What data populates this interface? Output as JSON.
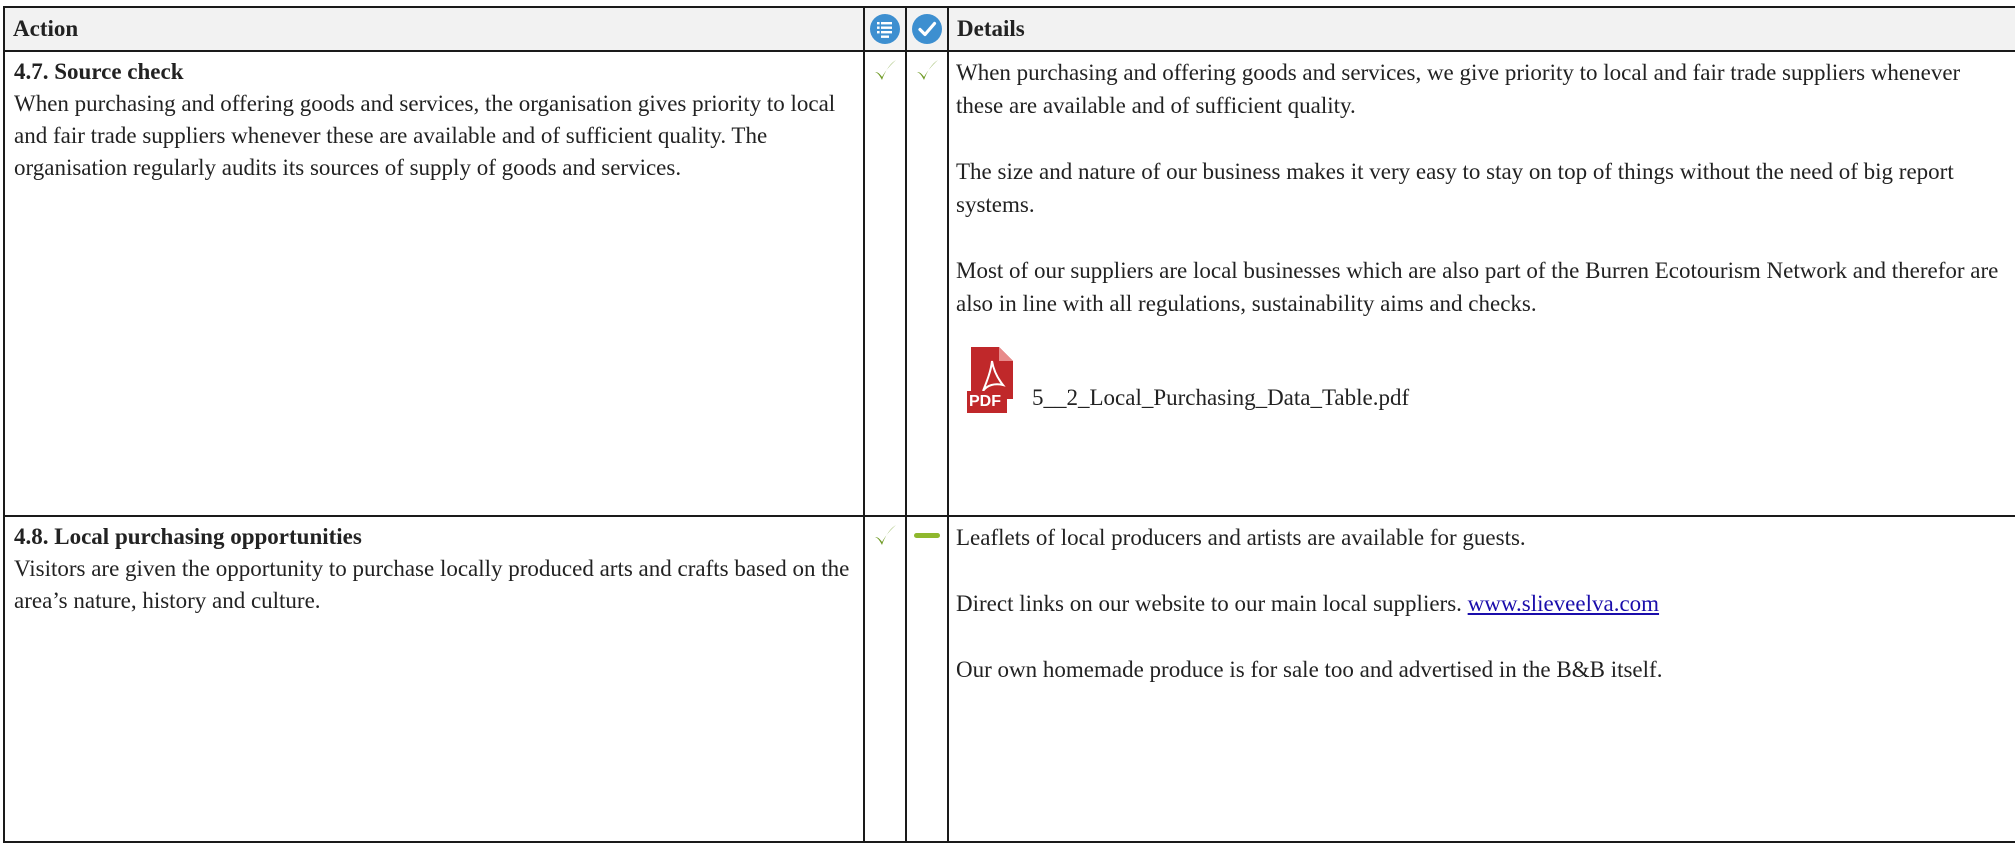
{
  "header": {
    "action_label": "Action",
    "details_label": "Details",
    "icon1": "list-icon",
    "icon2": "check-icon"
  },
  "colors": {
    "check": "#6e9a24",
    "dash": "#8fb82e",
    "header_icon": "#3d8fd0",
    "pdf": "#c0282a"
  },
  "rows": [
    {
      "title": "4.7. Source check",
      "description": "When purchasing and offering goods and services, the organisation gives priority to local and fair trade suppliers whenever these are available and of sufficient quality. The organisation regularly audits its sources of supply of goods and services.",
      "status1": "check",
      "status2": "check",
      "details": [
        "When purchasing and offering goods and services, we give priority to local and fair trade suppliers whenever these are available and of sufficient quality.",
        "The size and nature of our business makes it very easy to stay on top of things without the need of big report systems.",
        "Most of our suppliers are local businesses which are also part of the Burren Ecotourism Network and therefor are also in line with all regulations, sustainability aims and checks."
      ],
      "attachment": {
        "icon_label": "PDF",
        "filename": "5__2_Local_Purchasing_Data_Table.pdf"
      }
    },
    {
      "title": "4.8. Local purchasing opportunities",
      "description": "Visitors are given the opportunity to purchase locally produced arts and crafts based on the area’s nature, history and culture.",
      "status1": "check",
      "status2": "dash",
      "details": [
        "Leaflets of local producers and artists are available for guests.",
        "Direct links on our website to our main local suppliers. ",
        "Our own homemade produce is for sale too and advertised in the B&B itself."
      ],
      "link_text": "www.slieveelva.com"
    }
  ]
}
